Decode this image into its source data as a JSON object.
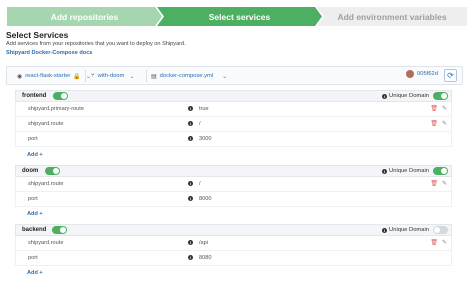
{
  "stepper": {
    "step1": "Add repositories",
    "step2": "Select services",
    "step3": "Add environment variables"
  },
  "section": {
    "title": "Select Services",
    "description": "Add services from your repositories that you want to deploy on Shipyard.",
    "doc_link": "Shipyard Docker-Compose docs"
  },
  "selector": {
    "repo": "react-flask-starter",
    "branch": "with-doom",
    "compose_file": "docker-compose.yml",
    "user": "005f62d"
  },
  "unique_domain_label": "Unique Domain",
  "add_label": "Add +",
  "services": [
    {
      "name": "frontend",
      "enabled": true,
      "unique_domain": true,
      "rows": [
        {
          "key": "shipyard.primary-route",
          "value": "true",
          "editable": true
        },
        {
          "key": "shipyard.route",
          "value": "/",
          "editable": true
        },
        {
          "key": "port",
          "value": "3000",
          "editable": false
        }
      ]
    },
    {
      "name": "doom",
      "enabled": true,
      "unique_domain": true,
      "rows": [
        {
          "key": "shipyard.route",
          "value": "/",
          "editable": true
        },
        {
          "key": "port",
          "value": "8000",
          "editable": false
        }
      ]
    },
    {
      "name": "backend",
      "enabled": true,
      "unique_domain": false,
      "rows": [
        {
          "key": "shipyard.route",
          "value": "/api",
          "editable": true
        },
        {
          "key": "port",
          "value": "8080",
          "editable": false
        }
      ]
    }
  ]
}
